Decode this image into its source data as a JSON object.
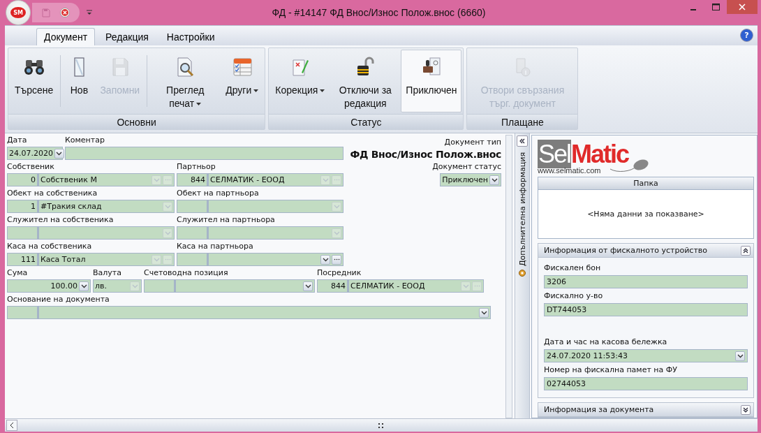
{
  "window": {
    "logo": "SM",
    "title": "ФД - #14147 ФД Внос/Износ Полож.внос (6660)",
    "help": "?"
  },
  "ribbon_tabs": [
    {
      "label": "Документ",
      "selected": true
    },
    {
      "label": "Редакция",
      "selected": false
    },
    {
      "label": "Настройки",
      "selected": false
    }
  ],
  "ribbon_groups": [
    {
      "title": "Основни",
      "items": [
        {
          "kind": "button",
          "label": "Търсене",
          "disabled": false,
          "dropdown": false,
          "pressed": false
        },
        {
          "kind": "separator"
        },
        {
          "kind": "button",
          "label": "Нов",
          "disabled": false,
          "dropdown": false,
          "pressed": false
        },
        {
          "kind": "button",
          "label": "Запомни",
          "disabled": true,
          "dropdown": false,
          "pressed": false
        },
        {
          "kind": "separator"
        },
        {
          "kind": "button",
          "label": "Преглед печат",
          "disabled": false,
          "dropdown": true,
          "pressed": false
        },
        {
          "kind": "button",
          "label": "Други",
          "disabled": false,
          "dropdown": true,
          "pressed": false
        }
      ]
    },
    {
      "title": "Статус",
      "items": [
        {
          "kind": "button",
          "label": "Корекция",
          "disabled": false,
          "dropdown": true,
          "pressed": false
        },
        {
          "kind": "button",
          "label": "Отключи за редакция",
          "disabled": false,
          "dropdown": false,
          "pressed": false
        },
        {
          "kind": "button",
          "label": "Приключен",
          "disabled": false,
          "dropdown": false,
          "pressed": true
        }
      ]
    },
    {
      "title": "Плащане",
      "items": [
        {
          "kind": "button",
          "label": "Отвори свързания търг. документ",
          "disabled": true,
          "dropdown": false,
          "pressed": false
        }
      ]
    }
  ],
  "form": {
    "rows": [
      {
        "fields": [
          {
            "kind": "date",
            "label": "Дата",
            "value": "24.07.2020",
            "enabled": true
          },
          {
            "kind": "text",
            "label": "Коментар"
          },
          {
            "kind": "heading",
            "label": "Документ тип",
            "value": "ФД Внос/Износ Полож.внос"
          }
        ]
      },
      {
        "fields": [
          {
            "kind": "lookup",
            "label": "Собственик",
            "code": "0",
            "value": "Собственик М",
            "ellipsis": true,
            "enabled": false
          },
          {
            "kind": "lookup",
            "label": "Партньор",
            "code": "844",
            "value": "СЕЛМАТИК - ЕООД",
            "ellipsis": true,
            "enabled": false
          },
          {
            "kind": "combo",
            "label": "Документ статус",
            "value": "Приключен",
            "enabled": true
          }
        ]
      },
      {
        "fields": [
          {
            "kind": "lookup",
            "label": "Обект на собственика",
            "code": "1",
            "value": "#Тракия склад",
            "ellipsis": false,
            "enabled": false
          },
          {
            "kind": "lookup",
            "label": "Обект на партньора",
            "ellipsis": false,
            "enabled": false
          }
        ]
      },
      {
        "fields": [
          {
            "kind": "lookup",
            "label": "Служител на собственика",
            "ellipsis": false,
            "enabled": false
          },
          {
            "kind": "lookup",
            "label": "Служител на партньора",
            "ellipsis": false,
            "enabled": false
          }
        ]
      },
      {
        "fields": [
          {
            "kind": "lookup",
            "label": "Каса на собственика",
            "code": "111",
            "value": "Каса Тотал",
            "ellipsis": true,
            "enabled": false
          },
          {
            "kind": "lookup",
            "label": "Каса на партньора",
            "ellipsis": true,
            "enabled": true
          }
        ]
      },
      {
        "fields": [
          {
            "kind": "amount",
            "label": "Сума",
            "value": "100.00",
            "enabled": true
          },
          {
            "kind": "combo",
            "label": "Валута",
            "value": "лв.",
            "enabled": false
          },
          {
            "kind": "lookup",
            "label": "Счетоводна позиция",
            "ellipsis": false,
            "enabled": true
          },
          {
            "kind": "lookup",
            "label": "Посредник",
            "code": "844",
            "value": "СЕЛМАТИК - ЕООД",
            "ellipsis": true,
            "enabled": false
          }
        ]
      },
      {
        "fields": [
          {
            "kind": "lookup",
            "label": "Основание на документа",
            "ellipsis": false,
            "enabled": true
          }
        ]
      }
    ]
  },
  "side_tab": {
    "label": "Допълнителна информация"
  },
  "info_panel": {
    "logo": {
      "part1": "Sel",
      "part2": "Matic",
      "url": "www.selmatic.com"
    },
    "folder": {
      "header": "Папка",
      "empty_text": "<Няма данни за показване>"
    },
    "sections": [
      {
        "title": "Информация от фискалното устройство",
        "expanded": true,
        "fields": [
          {
            "kind": "text",
            "label": "Фискален бон",
            "value": "3206"
          },
          {
            "kind": "text",
            "label": "Фискално у-во",
            "value": "DT744053"
          },
          {
            "kind": "spacer"
          },
          {
            "kind": "combo",
            "label": "Дата и час на касова бележка",
            "value": "24.07.2020 11:53:43"
          },
          {
            "kind": "text",
            "label": "Номер на фискална памет на ФУ",
            "value": "02744053"
          }
        ]
      },
      {
        "title": "Информация за документа",
        "expanded": false
      }
    ]
  }
}
